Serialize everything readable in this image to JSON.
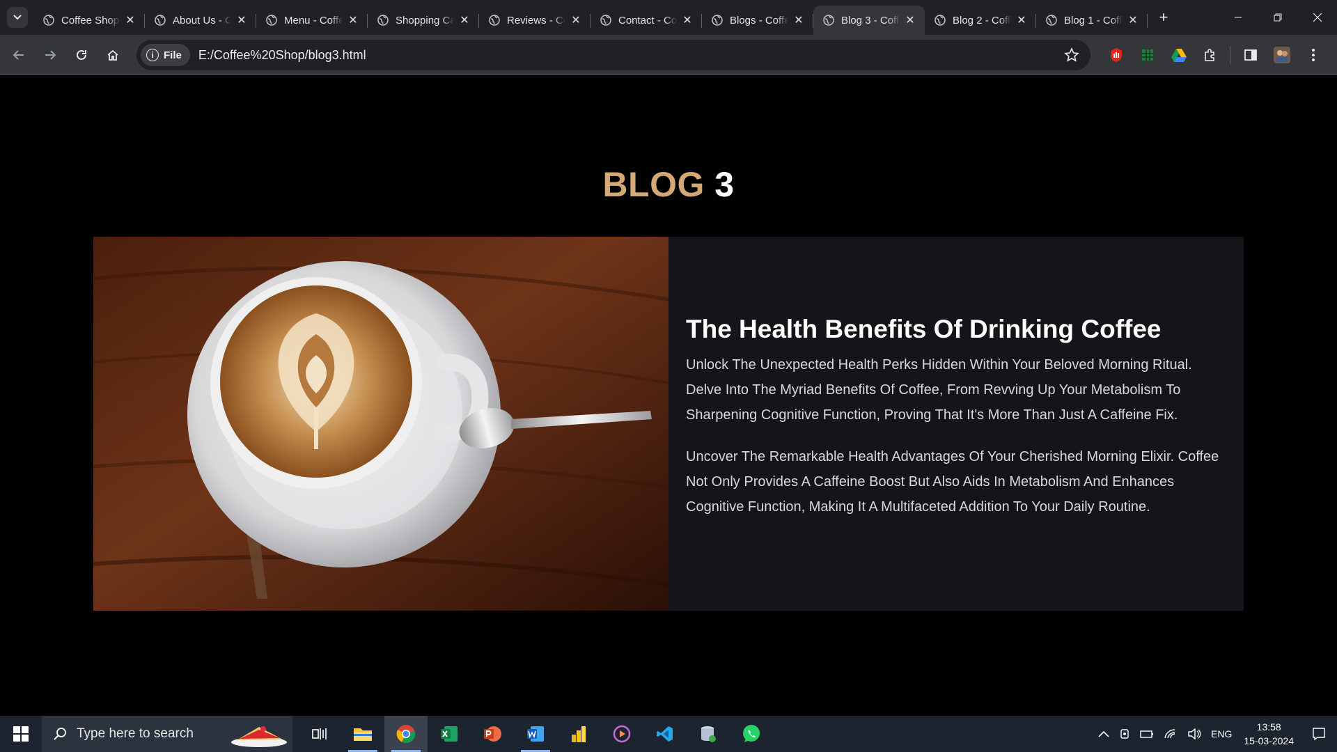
{
  "browser": {
    "tabs": [
      {
        "title": "Coffee Shop",
        "active": false
      },
      {
        "title": "About Us - Coffee Shop",
        "active": false
      },
      {
        "title": "Menu - Coffee Shop",
        "active": false
      },
      {
        "title": "Shopping Cart",
        "active": false
      },
      {
        "title": "Reviews - Coffee Shop",
        "active": false
      },
      {
        "title": "Contact - Coffee Shop",
        "active": false
      },
      {
        "title": "Blogs - Coffee Shop",
        "active": false
      },
      {
        "title": "Blog 3 - Coffee Shop",
        "active": true
      },
      {
        "title": "Blog 2 - Coffee Shop",
        "active": false
      },
      {
        "title": "Blog 1 - Coffee Shop",
        "active": false
      }
    ],
    "site_chip_label": "File",
    "url": "E:/Coffee%20Shop/blog3.html"
  },
  "page": {
    "heading_word1": "BLOG",
    "heading_word2": "3",
    "card": {
      "image_alt": "Latte art cup with spoon on wooden table",
      "title": "The Health Benefits Of Drinking Coffee",
      "paragraphs": [
        "Unlock The Unexpected Health Perks Hidden Within Your Beloved Morning Ritual. Delve Into The Myriad Benefits Of Coffee, From Revving Up Your Metabolism To Sharpening Cognitive Function, Proving That It's More Than Just A Caffeine Fix.",
        "Uncover The Remarkable Health Advantages Of Your Cherished Morning Elixir. Coffee Not Only Provides A Caffeine Boost But Also Aids In Metabolism And Enhances Cognitive Function, Making It A Multifaceted Addition To Your Daily Routine."
      ]
    }
  },
  "taskbar": {
    "search_placeholder": "Type here to search",
    "language": "ENG",
    "time": "13:58",
    "date": "15-03-2024"
  },
  "colors": {
    "accent_heading": "#d3a875",
    "card_bg": "#141519",
    "page_bg": "#000000"
  }
}
